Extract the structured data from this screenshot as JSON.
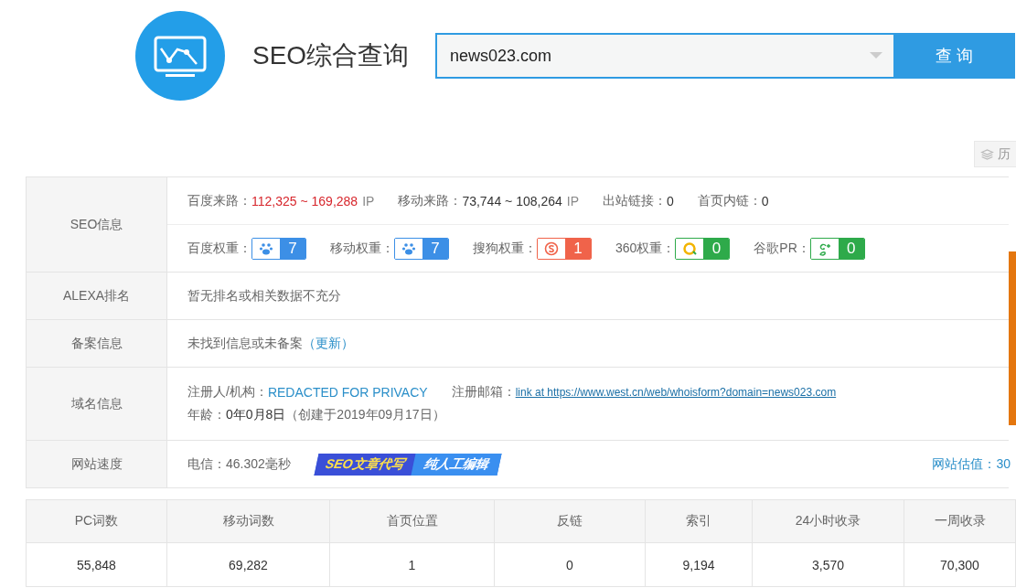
{
  "header": {
    "title": "SEO综合查询",
    "search": {
      "value": "news023.com"
    },
    "search_button": "查 询",
    "history_button": "历"
  },
  "info": {
    "seo": {
      "label": "SEO信息",
      "traffic": [
        {
          "label": "百度来路：",
          "value": "112,325 ~ 169,288",
          "unit": "IP",
          "highlight": true
        },
        {
          "label": "移动来路：",
          "value": "73,744 ~ 108,264",
          "unit": "IP",
          "highlight": false
        },
        {
          "label": "出站链接：",
          "value": "0",
          "highlight": false
        },
        {
          "label": "首页内链：",
          "value": "0",
          "highlight": false
        }
      ],
      "weights": [
        {
          "label": "百度权重：",
          "kind": "baidu",
          "value": "7",
          "color": "#3c8fe6"
        },
        {
          "label": "移动权重：",
          "kind": "baidu",
          "value": "7",
          "color": "#3c8fe6"
        },
        {
          "label": "搜狗权重：",
          "kind": "sogou",
          "value": "1",
          "color": "#f0634a"
        },
        {
          "label": "360权重：",
          "kind": "q360",
          "value": "0",
          "color": "#2eaa4a"
        },
        {
          "label": "谷歌PR：",
          "kind": "google",
          "value": "0",
          "color": "#2eaa4a"
        }
      ]
    },
    "alexa": {
      "label": "ALEXA排名",
      "text": "暂无排名或相关数据不充分"
    },
    "icp": {
      "label": "备案信息",
      "text": "未找到信息或未备案",
      "link": "（更新）"
    },
    "domain": {
      "label": "域名信息",
      "registrant_label": "注册人/机构：",
      "registrant": "REDACTED FOR PRIVACY",
      "email_label": "注册邮箱：",
      "email": "link at https://www.west.cn/web/whoisform?domain=news023.com",
      "age_label": "年龄：",
      "age": "0年0月8日",
      "created": "（创建于2019年09月17日）"
    },
    "speed": {
      "label": "网站速度",
      "text": "电信：46.302毫秒",
      "ad": [
        "SEO文章代写",
        "纯人工编辑"
      ],
      "valuation": "网站估值：30"
    }
  },
  "stats": {
    "columns": [
      "PC词数",
      "移动词数",
      "首页位置",
      "反链",
      "索引",
      "24小时收录",
      "一周收录"
    ],
    "values": [
      "55,848",
      "69,282",
      "1",
      "0",
      "9,194",
      "3,570",
      "70,300"
    ]
  }
}
